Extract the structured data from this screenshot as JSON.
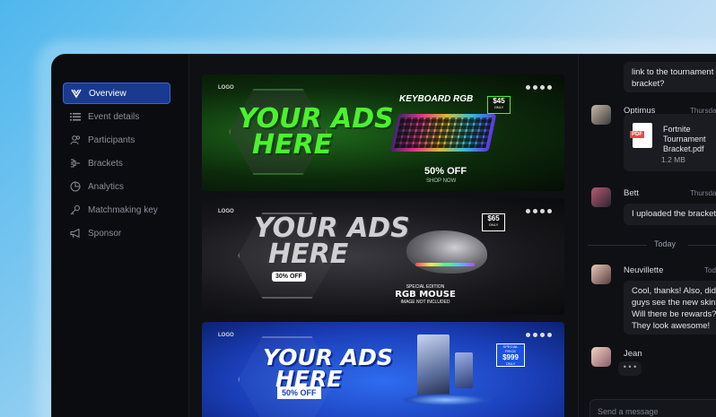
{
  "sidebar": {
    "items": [
      {
        "label": "Overview",
        "icon": "chevron-logo-icon",
        "active": true
      },
      {
        "label": "Event details",
        "icon": "list-icon"
      },
      {
        "label": "Participants",
        "icon": "users-icon"
      },
      {
        "label": "Brackets",
        "icon": "bracket-icon"
      },
      {
        "label": "Analytics",
        "icon": "pie-chart-icon"
      },
      {
        "label": "Matchmaking key",
        "icon": "key-icon"
      },
      {
        "label": "Sponsor",
        "icon": "megaphone-icon"
      }
    ]
  },
  "banners": [
    {
      "logo": "LOGO",
      "title_line1": "YOUR ADS",
      "title_line2": "HERE",
      "product": "KEYBOARD RGB",
      "price": "$45",
      "price_note": "ONLY",
      "offer": "50% OFF",
      "subline": "SHOP NOW",
      "colors": {
        "accent": "#4bf22d"
      }
    },
    {
      "logo": "LOGO",
      "title_line1": "YOUR ADS",
      "title_line2": "HERE",
      "price": "$65",
      "price_note": "ONLY",
      "offer": "30% OFF",
      "edition_top": "SPECIAL EDITION",
      "edition_main": "RGB MOUSE",
      "edition_note": "IMAGE NOT INCLUDED"
    },
    {
      "logo": "LOGO",
      "title_line1": "YOUR ADS",
      "title_line2": "HERE",
      "price_top": "SPECIAL PRICE",
      "price": "$999",
      "price_note": "ONLY",
      "offer": "50% OFF",
      "colors": {
        "accent": "#2f6cf0"
      }
    }
  ],
  "chat": {
    "top_message": "link to the tournament bracket?",
    "messages": [
      {
        "user": "Optimus",
        "time": "Thursday",
        "file_name": "Fortnite Tournament Bracket.pdf",
        "file_size": "1.2 MB",
        "file_type": "PDF"
      },
      {
        "user": "Bett",
        "time": "Thursday",
        "text": "I uploaded the bracket"
      },
      {
        "user": "Neuvillette",
        "time": "Today",
        "text": "Cool, thanks! Also, did you guys see the new skin? Will there be rewards? They look awesome!"
      },
      {
        "user": "Jean",
        "time": "",
        "typing": "• • •"
      }
    ],
    "day_separator": "Today",
    "input_placeholder": "Send a message"
  }
}
